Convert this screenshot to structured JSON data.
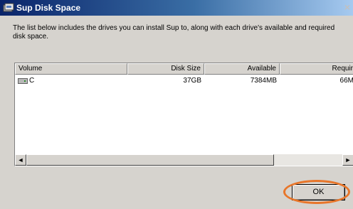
{
  "window": {
    "title": "Sup Disk Space",
    "close_glyph": "×",
    "icon": "disk-app-icon"
  },
  "description": "The list below includes the drives you can install Sup to, along with each drive's available and required disk space.",
  "table": {
    "columns": [
      "Volume",
      "Disk Size",
      "Available",
      "Requir"
    ],
    "rows": [
      {
        "volume": "C",
        "disk_size": "37GB",
        "available": "7384MB",
        "required": "66M",
        "icon": "hard-drive-icon"
      }
    ]
  },
  "scrollbar": {
    "left_arrow": "◄",
    "right_arrow": "►"
  },
  "buttons": {
    "ok_label": "OK"
  },
  "colors": {
    "title_gradient_start": "#0a246a",
    "title_gradient_end": "#a6caf0",
    "dialog_background": "#d6d3ce",
    "highlight_ring": "#e8762a"
  }
}
